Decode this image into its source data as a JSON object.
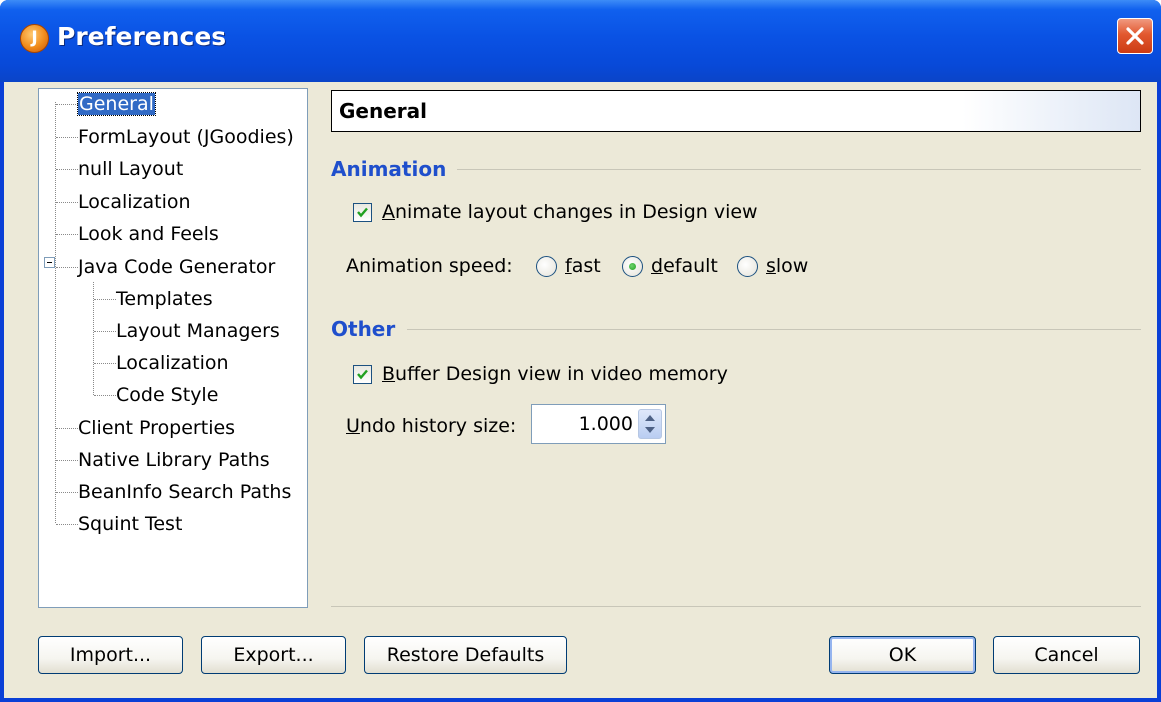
{
  "window": {
    "title": "Preferences",
    "app_icon_letter": "J"
  },
  "tree": {
    "items": [
      {
        "label": "General",
        "selected": true
      },
      {
        "label": "FormLayout (JGoodies)"
      },
      {
        "label": "null Layout"
      },
      {
        "label": "Localization"
      },
      {
        "label": "Look and Feels"
      },
      {
        "label": "Java Code Generator",
        "expanded": true
      },
      {
        "label": "Templates"
      },
      {
        "label": "Layout Managers"
      },
      {
        "label": "Localization"
      },
      {
        "label": "Code Style"
      },
      {
        "label": "Client Properties"
      },
      {
        "label": "Native Library Paths"
      },
      {
        "label": "BeanInfo Search Paths"
      },
      {
        "label": "Squint Test"
      }
    ]
  },
  "panel": {
    "header": "General",
    "animation": {
      "section_title": "Animation",
      "animate_checkbox": {
        "mnemonic": "A",
        "rest": "nimate layout changes in Design view",
        "checked": true
      },
      "speed_label": "Animation speed:",
      "speed_options": [
        {
          "mnemonic": "f",
          "rest": "ast",
          "selected": false
        },
        {
          "mnemonic": "d",
          "rest": "efault",
          "selected": true
        },
        {
          "mnemonic": "s",
          "rest": "low",
          "selected": false
        }
      ]
    },
    "other": {
      "section_title": "Other",
      "buffer_checkbox": {
        "mnemonic": "B",
        "rest": "uffer Design view in video memory",
        "checked": true
      },
      "undo_label": {
        "mnemonic": "U",
        "rest": "ndo history size:"
      },
      "undo_value": "1.000"
    }
  },
  "buttons": {
    "import": "Import...",
    "export": "Export...",
    "restore": "Restore Defaults",
    "ok": "OK",
    "cancel": "Cancel"
  },
  "colors": {
    "titlebar": "#0a52e4",
    "section_title": "#1f4fcc",
    "selection": "#316ac5",
    "dialog_bg": "#ece9d8"
  }
}
